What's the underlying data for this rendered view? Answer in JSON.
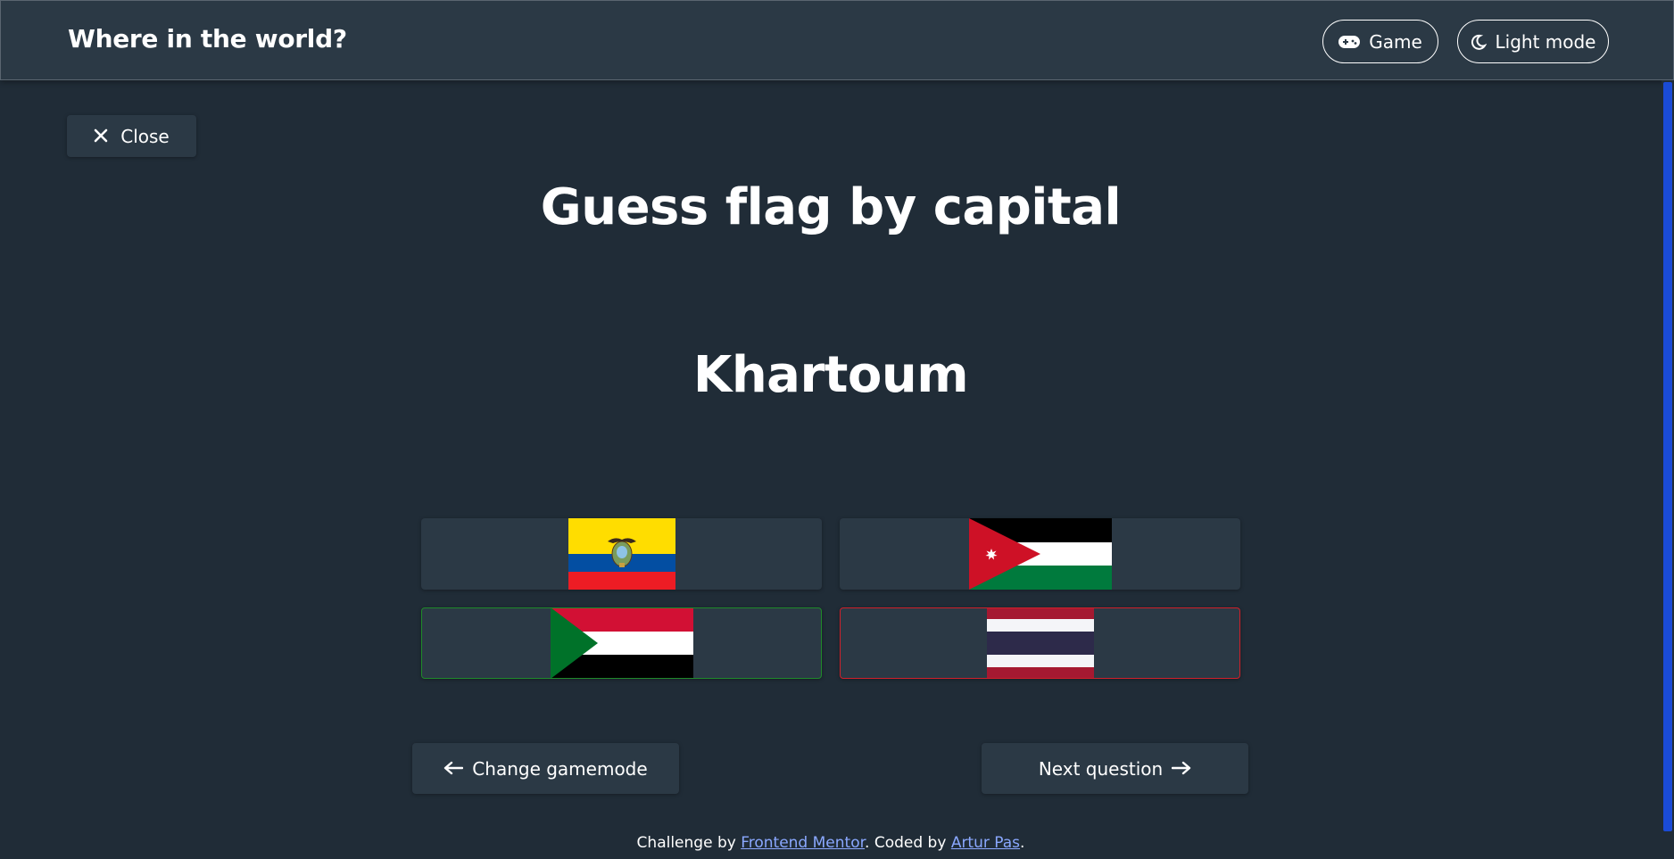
{
  "header": {
    "title": "Where in the world?",
    "game_label": "Game",
    "theme_label": "Light mode"
  },
  "close_label": "Close",
  "quiz": {
    "title": "Guess flag by capital",
    "capital": "Khartoum",
    "options": [
      {
        "flag": "ecuador-flag",
        "state": "neutral"
      },
      {
        "flag": "jordan-flag",
        "state": "neutral"
      },
      {
        "flag": "sudan-flag",
        "state": "correct"
      },
      {
        "flag": "thailand-flag",
        "state": "wrong"
      }
    ]
  },
  "nav": {
    "prev_label": "Change gamemode",
    "next_label": "Next question"
  },
  "footer": {
    "prefix": "Challenge by ",
    "mentor_link": "Frontend Mentor",
    "middle": ". Coded by ",
    "author_link": "Artur Pas",
    "suffix": "."
  },
  "colors": {
    "background": "#202c37",
    "elements": "#2b3945",
    "correct_border": "#1f8a2a",
    "wrong_border": "#d0202a",
    "link": "#8aa8ff",
    "scrollbar": "#1a4bd6"
  }
}
